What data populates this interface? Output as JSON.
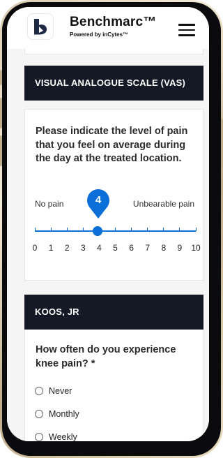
{
  "app": {
    "title": "Benchmarc™",
    "subtitle": "Powered by inCytes™",
    "menu_icon": "hamburger-menu-icon",
    "logo_icon": "benchmarc-logo-icon",
    "brand_color": "#1f2a44"
  },
  "vas": {
    "section_title": "VISUAL ANALOGUE SCALE (VAS)",
    "question": "Please indicate the level of pain that you feel on average during the day at the treated location.",
    "min_label": "No pain",
    "max_label": "Unbearable pain",
    "selected_value": "4",
    "scale": [
      "0",
      "1",
      "2",
      "3",
      "4",
      "5",
      "6",
      "7",
      "8",
      "9",
      "10"
    ],
    "accent_color": "#0a6fd8"
  },
  "koos": {
    "section_title": "KOOS, JR",
    "question": "How often do you experience knee pain? *",
    "options": [
      "Never",
      "Monthly",
      "Weekly"
    ]
  }
}
